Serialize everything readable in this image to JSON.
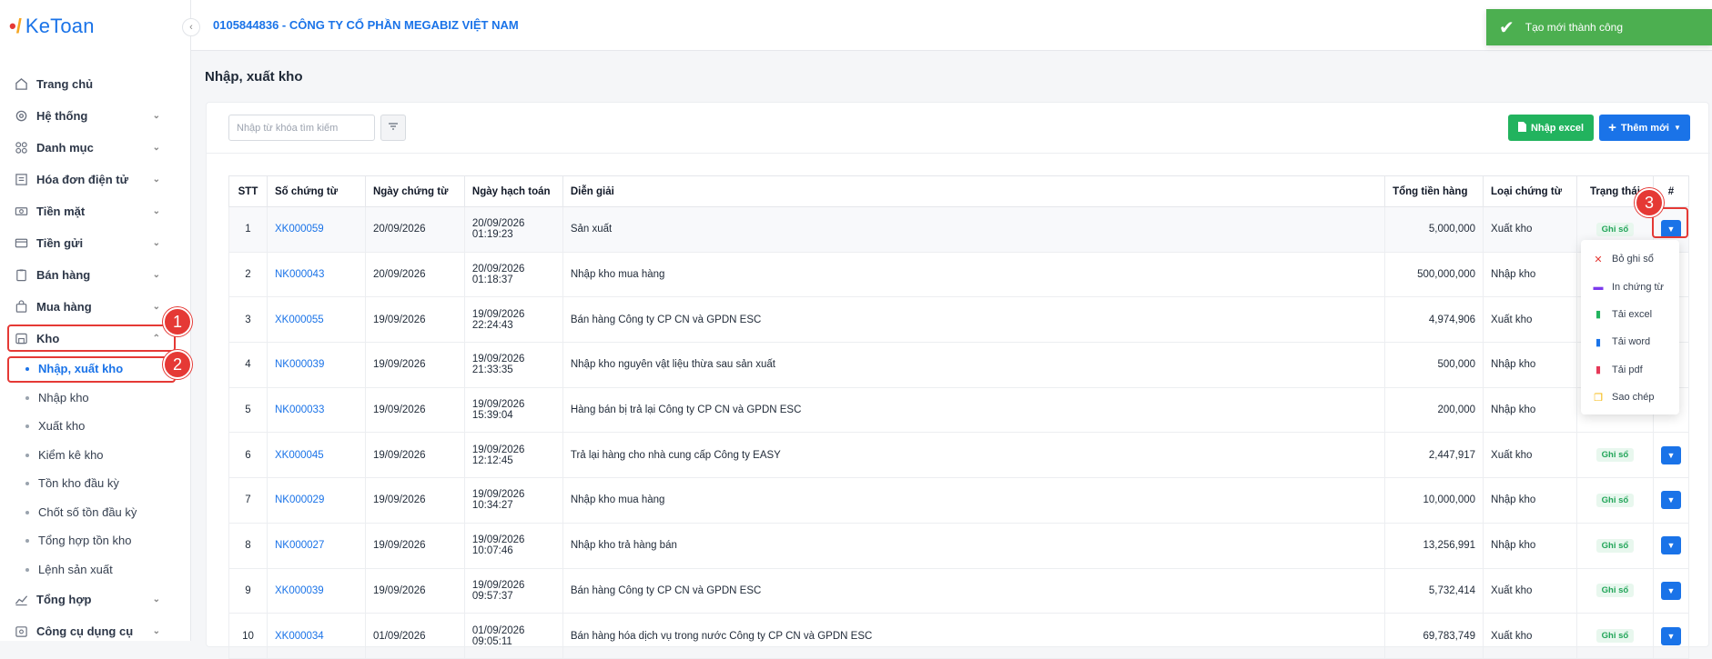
{
  "app": {
    "logo_text": "KeToan"
  },
  "header": {
    "company": "0105844836 - CÔNG TY CỔ PHẦN MEGABIZ VIỆT NAM"
  },
  "toast": {
    "message": "Tạo mới thành công",
    "color": "#4caf50"
  },
  "sidebar": {
    "items": [
      {
        "label": "Trang chủ",
        "icon": "home-icon"
      },
      {
        "label": "Hệ thống",
        "icon": "gear-icon"
      },
      {
        "label": "Danh mục",
        "icon": "grid-icon"
      },
      {
        "label": "Hóa đơn điện tử",
        "icon": "invoice-icon"
      },
      {
        "label": "Tiền mặt",
        "icon": "cash-icon"
      },
      {
        "label": "Tiền gửi",
        "icon": "card-icon"
      },
      {
        "label": "Bán hàng",
        "icon": "clipboard-icon"
      },
      {
        "label": "Mua hàng",
        "icon": "bag-icon"
      },
      {
        "label": "Kho",
        "icon": "warehouse-icon"
      }
    ],
    "kho_sub": [
      "Nhập, xuất kho",
      "Nhập kho",
      "Xuất kho",
      "Kiểm kê kho",
      "Tồn kho đầu kỳ",
      "Chốt số tồn đầu kỳ",
      "Tổng hợp tồn kho",
      "Lệnh sản xuất"
    ],
    "bottom_items": [
      {
        "label": "Tổng hợp",
        "icon": "chart-icon"
      },
      {
        "label": "Công cụ dụng cụ",
        "icon": "tools-icon"
      }
    ]
  },
  "annotations": {
    "one": "1",
    "two": "2",
    "three": "3"
  },
  "page": {
    "title": "Nhập, xuất kho"
  },
  "toolbar": {
    "search_placeholder": "Nhập từ khóa tìm kiếm",
    "import_excel": "Nhập excel",
    "add_new": "Thêm mới"
  },
  "table": {
    "headers": [
      "STT",
      "Số chứng từ",
      "Ngày chứng từ",
      "Ngày hạch toán",
      "Diễn giải",
      "Tổng tiền hàng",
      "Loại chứng từ",
      "Trạng thái",
      "#"
    ],
    "rows": [
      {
        "stt": "1",
        "so": "XK000059",
        "ngay_ct": "20/09/2026",
        "ngay_ht_d": "20/09/2026",
        "ngay_ht_t": "01:19:23",
        "dien_giai": "Sản xuất",
        "tong": "5,000,000",
        "loai": "Xuất kho",
        "trang_thai": "Ghi sổ"
      },
      {
        "stt": "2",
        "so": "NK000043",
        "ngay_ct": "20/09/2026",
        "ngay_ht_d": "20/09/2026",
        "ngay_ht_t": "01:18:37",
        "dien_giai": "Nhập kho mua hàng",
        "tong": "500,000,000",
        "loai": "Nhập kho",
        "trang_thai": ""
      },
      {
        "stt": "3",
        "so": "XK000055",
        "ngay_ct": "19/09/2026",
        "ngay_ht_d": "19/09/2026",
        "ngay_ht_t": "22:24:43",
        "dien_giai": "Bán hàng Công ty CP CN và GPDN ESC",
        "tong": "4,974,906",
        "loai": "Xuất kho",
        "trang_thai": ""
      },
      {
        "stt": "4",
        "so": "NK000039",
        "ngay_ct": "19/09/2026",
        "ngay_ht_d": "19/09/2026",
        "ngay_ht_t": "21:33:35",
        "dien_giai": "Nhập kho nguyên vật liệu thừa sau sản xuất",
        "tong": "500,000",
        "loai": "Nhập kho",
        "trang_thai": ""
      },
      {
        "stt": "5",
        "so": "NK000033",
        "ngay_ct": "19/09/2026",
        "ngay_ht_d": "19/09/2026",
        "ngay_ht_t": "15:39:04",
        "dien_giai": "Hàng bán bị trả lại Công ty CP CN và GPDN ESC",
        "tong": "200,000",
        "loai": "Nhập kho",
        "trang_thai": ""
      },
      {
        "stt": "6",
        "so": "XK000045",
        "ngay_ct": "19/09/2026",
        "ngay_ht_d": "19/09/2026",
        "ngay_ht_t": "12:12:45",
        "dien_giai": "Trả lại hàng cho nhà cung cấp Công ty EASY",
        "tong": "2,447,917",
        "loai": "Xuất kho",
        "trang_thai": "Ghi sổ"
      },
      {
        "stt": "7",
        "so": "NK000029",
        "ngay_ct": "19/09/2026",
        "ngay_ht_d": "19/09/2026",
        "ngay_ht_t": "10:34:27",
        "dien_giai": "Nhập kho mua hàng",
        "tong": "10,000,000",
        "loai": "Nhập kho",
        "trang_thai": "Ghi sổ"
      },
      {
        "stt": "8",
        "so": "NK000027",
        "ngay_ct": "19/09/2026",
        "ngay_ht_d": "19/09/2026",
        "ngay_ht_t": "10:07:46",
        "dien_giai": "Nhập kho trả hàng bán",
        "tong": "13,256,991",
        "loai": "Nhập kho",
        "trang_thai": "Ghi sổ"
      },
      {
        "stt": "9",
        "so": "XK000039",
        "ngay_ct": "19/09/2026",
        "ngay_ht_d": "19/09/2026",
        "ngay_ht_t": "09:57:37",
        "dien_giai": "Bán hàng Công ty CP CN và GPDN ESC",
        "tong": "5,732,414",
        "loai": "Xuất kho",
        "trang_thai": "Ghi sổ"
      },
      {
        "stt": "10",
        "so": "XK000034",
        "ngay_ct": "01/09/2026",
        "ngay_ht_d": "01/09/2026",
        "ngay_ht_t": "09:05:11",
        "dien_giai": "Bán hàng hóa dịch vụ trong nước Công ty CP CN và GPDN ESC",
        "tong": "69,783,749",
        "loai": "Xuất kho",
        "trang_thai": "Ghi sổ"
      }
    ]
  },
  "dropdown": {
    "items": [
      {
        "label": "Bỏ ghi sổ",
        "icon": "close-icon",
        "color": "#e53935"
      },
      {
        "label": "In chứng từ",
        "icon": "printer-icon",
        "color": "#7c3aed"
      },
      {
        "label": "Tải excel",
        "icon": "excel-file-icon",
        "color": "#22b35e"
      },
      {
        "label": "Tải word",
        "icon": "word-file-icon",
        "color": "#1a73e8"
      },
      {
        "label": "Tải pdf",
        "icon": "pdf-file-icon",
        "color": "#e53958"
      },
      {
        "label": "Sao chép",
        "icon": "copy-icon",
        "color": "#f5b400"
      }
    ]
  }
}
